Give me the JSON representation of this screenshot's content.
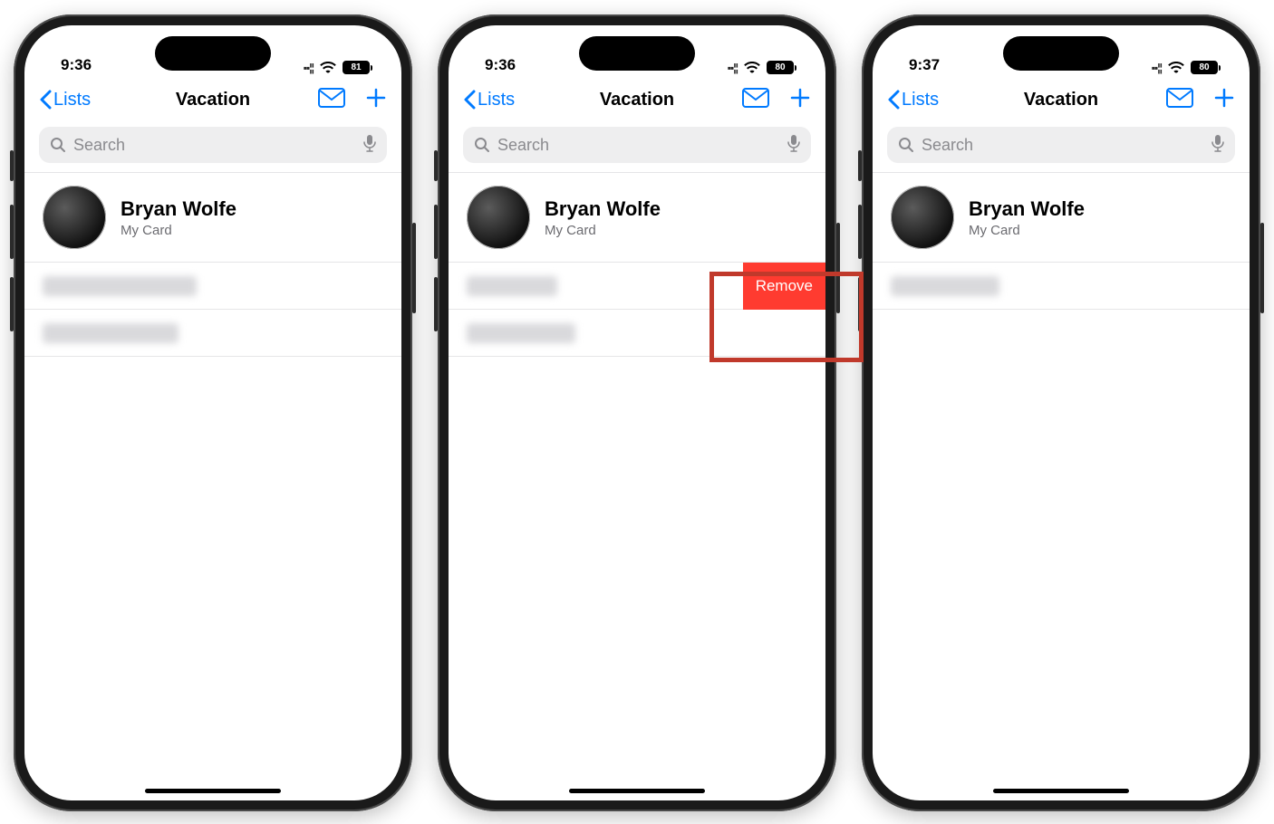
{
  "screens": [
    {
      "time": "9:36",
      "battery": "81",
      "back_label": "Lists",
      "title": "Vacation",
      "search_placeholder": "Search",
      "card_name": "Bryan Wolfe",
      "card_sub": "My Card",
      "rows": [
        "blurred",
        "blurred"
      ],
      "show_remove": false
    },
    {
      "time": "9:36",
      "battery": "80",
      "back_label": "Lists",
      "title": "Vacation",
      "search_placeholder": "Search",
      "card_name": "Bryan Wolfe",
      "card_sub": "My Card",
      "rows": [
        "blurred",
        "blurred"
      ],
      "show_remove": true,
      "remove_label": "Remove"
    },
    {
      "time": "9:37",
      "battery": "80",
      "back_label": "Lists",
      "title": "Vacation",
      "search_placeholder": "Search",
      "card_name": "Bryan Wolfe",
      "card_sub": "My Card",
      "rows": [
        "blurred"
      ],
      "show_remove": false
    }
  ]
}
